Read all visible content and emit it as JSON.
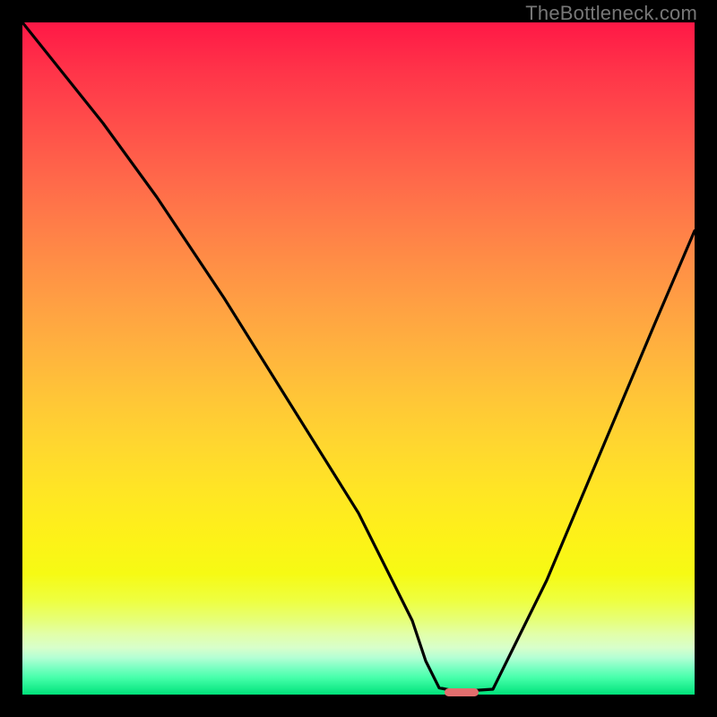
{
  "watermark": {
    "text": "TheBottleneck.com"
  },
  "chart_data": {
    "type": "line",
    "title": "",
    "xlabel": "",
    "ylabel": "",
    "xlim": [
      0,
      100
    ],
    "ylim": [
      0,
      100
    ],
    "grid": false,
    "series": [
      {
        "name": "bottleneck-curve",
        "x": [
          0,
          12,
          20,
          30,
          40,
          50,
          58,
          60,
          62,
          64,
          67,
          70,
          78,
          86,
          94,
          100
        ],
        "values": [
          100,
          85,
          74,
          59,
          43,
          27,
          11,
          5,
          1,
          0.6,
          0.6,
          0.8,
          17,
          36,
          55,
          69
        ]
      }
    ],
    "marker": {
      "name": "optimal-pill",
      "color": "#e26e6e",
      "x_center_pct": 65.3,
      "y_from_bottom_pct": 0.35,
      "width_pct": 5.0,
      "height_pct": 1.1
    },
    "gradient_stops": [
      {
        "pct": 0,
        "color": "#ff1846"
      },
      {
        "pct": 50,
        "color": "#ffb33e"
      },
      {
        "pct": 82,
        "color": "#f6fa14"
      },
      {
        "pct": 100,
        "color": "#00e27a"
      }
    ]
  }
}
